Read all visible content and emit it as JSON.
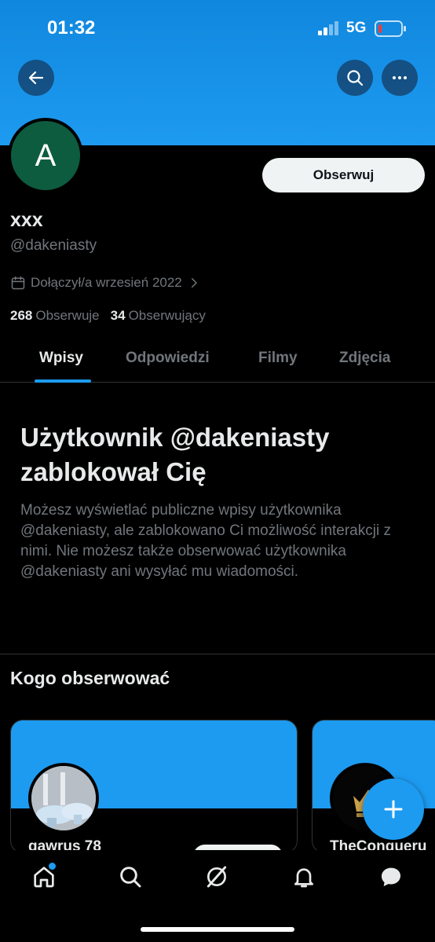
{
  "status_bar": {
    "time": "01:32",
    "network": "5G",
    "battery_level": 0.1
  },
  "header": {
    "back_icon": "arrow-left-icon",
    "search_icon": "search-icon",
    "more_icon": "ellipsis-icon"
  },
  "profile": {
    "avatar_letter": "A",
    "avatar_color": "#0d5c40",
    "display_name": "xxx",
    "handle": "@dakeniasty",
    "follow_label": "Obserwuj",
    "joined": "Dołączył/a wrzesień 2022",
    "following_count": "268",
    "following_label": "Obserwuje",
    "followers_count": "34",
    "followers_label": "Obserwujący"
  },
  "tabs": [
    {
      "label": "Wpisy",
      "active": true
    },
    {
      "label": "Odpowiedzi",
      "active": false
    },
    {
      "label": "Filmy",
      "active": false
    },
    {
      "label": "Zdjęcia",
      "active": false
    }
  ],
  "blocked": {
    "title": "Użytkownik @dakeniasty zablokował Cię",
    "description": "Możesz wyświetlać publiczne wpisy użytkownika @dakeniasty, ale zablokowano Ci możliwość interakcji z nimi. Nie możesz także obserwować użytkownika @dakeniasty ani wysyłać mu wiadomości."
  },
  "who_to_follow": {
    "title": "Kogo obserwować",
    "cards": [
      {
        "name": "gawrus 78"
      },
      {
        "name": "TheConqueru"
      }
    ]
  },
  "bottom_nav": {
    "items": [
      "home-icon",
      "search-icon",
      "grok-icon",
      "bell-icon",
      "messages-icon"
    ]
  },
  "colors": {
    "accent": "#1d9bf0",
    "background": "#000000",
    "muted": "#71767b",
    "text": "#e7e9ea"
  }
}
